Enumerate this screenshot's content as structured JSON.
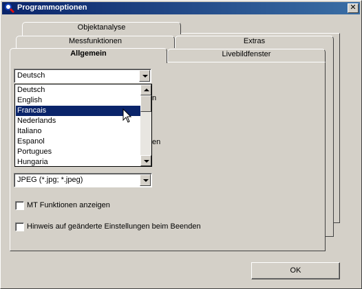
{
  "window": {
    "title": "Programmoptionen",
    "close_label": "✕"
  },
  "tabs": {
    "row1": [
      "Objektanalyse"
    ],
    "row2": [
      "Messfunktionen",
      "Extras"
    ],
    "row3": [
      "Allgemein",
      "Livebildfenster"
    ],
    "active": "Allgemein"
  },
  "language_combo": {
    "value": "Deutsch"
  },
  "language_list": {
    "items": [
      "Deutsch",
      "English",
      "Francais",
      "Nederlands",
      "Italiano",
      "Espanol",
      "Portugues",
      "Hungaria"
    ],
    "selected": "Francais"
  },
  "hidden_text": {
    "peek1": "n",
    "peek2": "en"
  },
  "format_combo": {
    "value": "JPEG (*.jpg; *.jpeg)"
  },
  "options": {
    "mt_functions_label": "MT Funktionen anzeigen",
    "mt_functions_checked": false,
    "notify_on_exit_label": "Hinweis auf geänderte Einstellungen beim Beenden",
    "notify_on_exit_checked": false
  },
  "footer": {
    "ok_label": "OK"
  },
  "icons": {
    "title": "magnifier-icon",
    "cursor": "arrow-cursor"
  }
}
